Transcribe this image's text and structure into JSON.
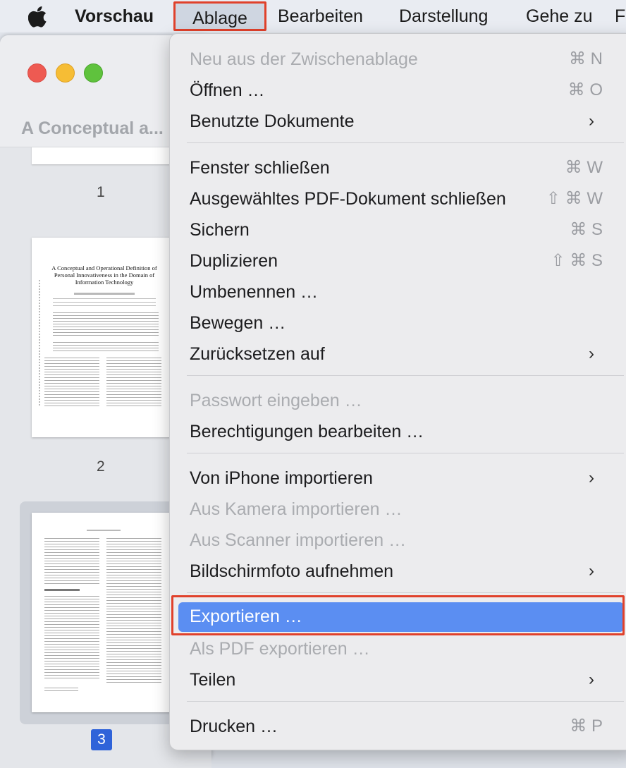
{
  "menubar": {
    "app_name": "Vorschau",
    "items": [
      "Ablage",
      "Bearbeiten",
      "Darstellung",
      "Gehe zu",
      "F"
    ]
  },
  "window": {
    "title": "A Conceptual a..."
  },
  "sidebar": {
    "pages": [
      "1",
      "2",
      "3"
    ],
    "thumbnail_title": "A Conceptual and Operational Definition of Personal Innovativeness in the Domain of Information Technology"
  },
  "menu": {
    "items": [
      {
        "label": "Neu aus der Zwischenablage",
        "shortcut": "⌘ N",
        "disabled": true
      },
      {
        "label": "Öffnen …",
        "shortcut": "⌘ O"
      },
      {
        "label": "Benutzte Dokumente",
        "submenu": true
      },
      {
        "label": "Fenster schließen",
        "shortcut": "⌘ W"
      },
      {
        "label": "Ausgewähltes PDF-Dokument schließen",
        "shortcut": "⇧ ⌘ W"
      },
      {
        "label": "Sichern",
        "shortcut": "⌘ S"
      },
      {
        "label": "Duplizieren",
        "shortcut": "⇧ ⌘ S"
      },
      {
        "label": "Umbenennen …"
      },
      {
        "label": "Bewegen …"
      },
      {
        "label": "Zurücksetzen auf",
        "submenu": true
      },
      {
        "label": "Passwort eingeben …",
        "disabled": true
      },
      {
        "label": "Berechtigungen bearbeiten …"
      },
      {
        "label": "Von iPhone importieren",
        "submenu": true
      },
      {
        "label": "Aus Kamera importieren …",
        "disabled": true
      },
      {
        "label": "Aus Scanner importieren …",
        "disabled": true
      },
      {
        "label": "Bildschirmfoto aufnehmen",
        "submenu": true
      },
      {
        "label": "Exportieren …",
        "highlighted": true
      },
      {
        "label": "Als PDF exportieren …",
        "disabled": true
      },
      {
        "label": "Teilen",
        "submenu": true
      },
      {
        "label": "Drucken …",
        "shortcut": "⌘ P"
      }
    ],
    "submenu_arrow": "›"
  },
  "colors": {
    "highlight": "#5b8ef2",
    "annotation_box": "#e0412b",
    "selected_page_badge": "#2f63d9"
  },
  "icons": [
    "apple-icon",
    "chevron-right-icon"
  ]
}
